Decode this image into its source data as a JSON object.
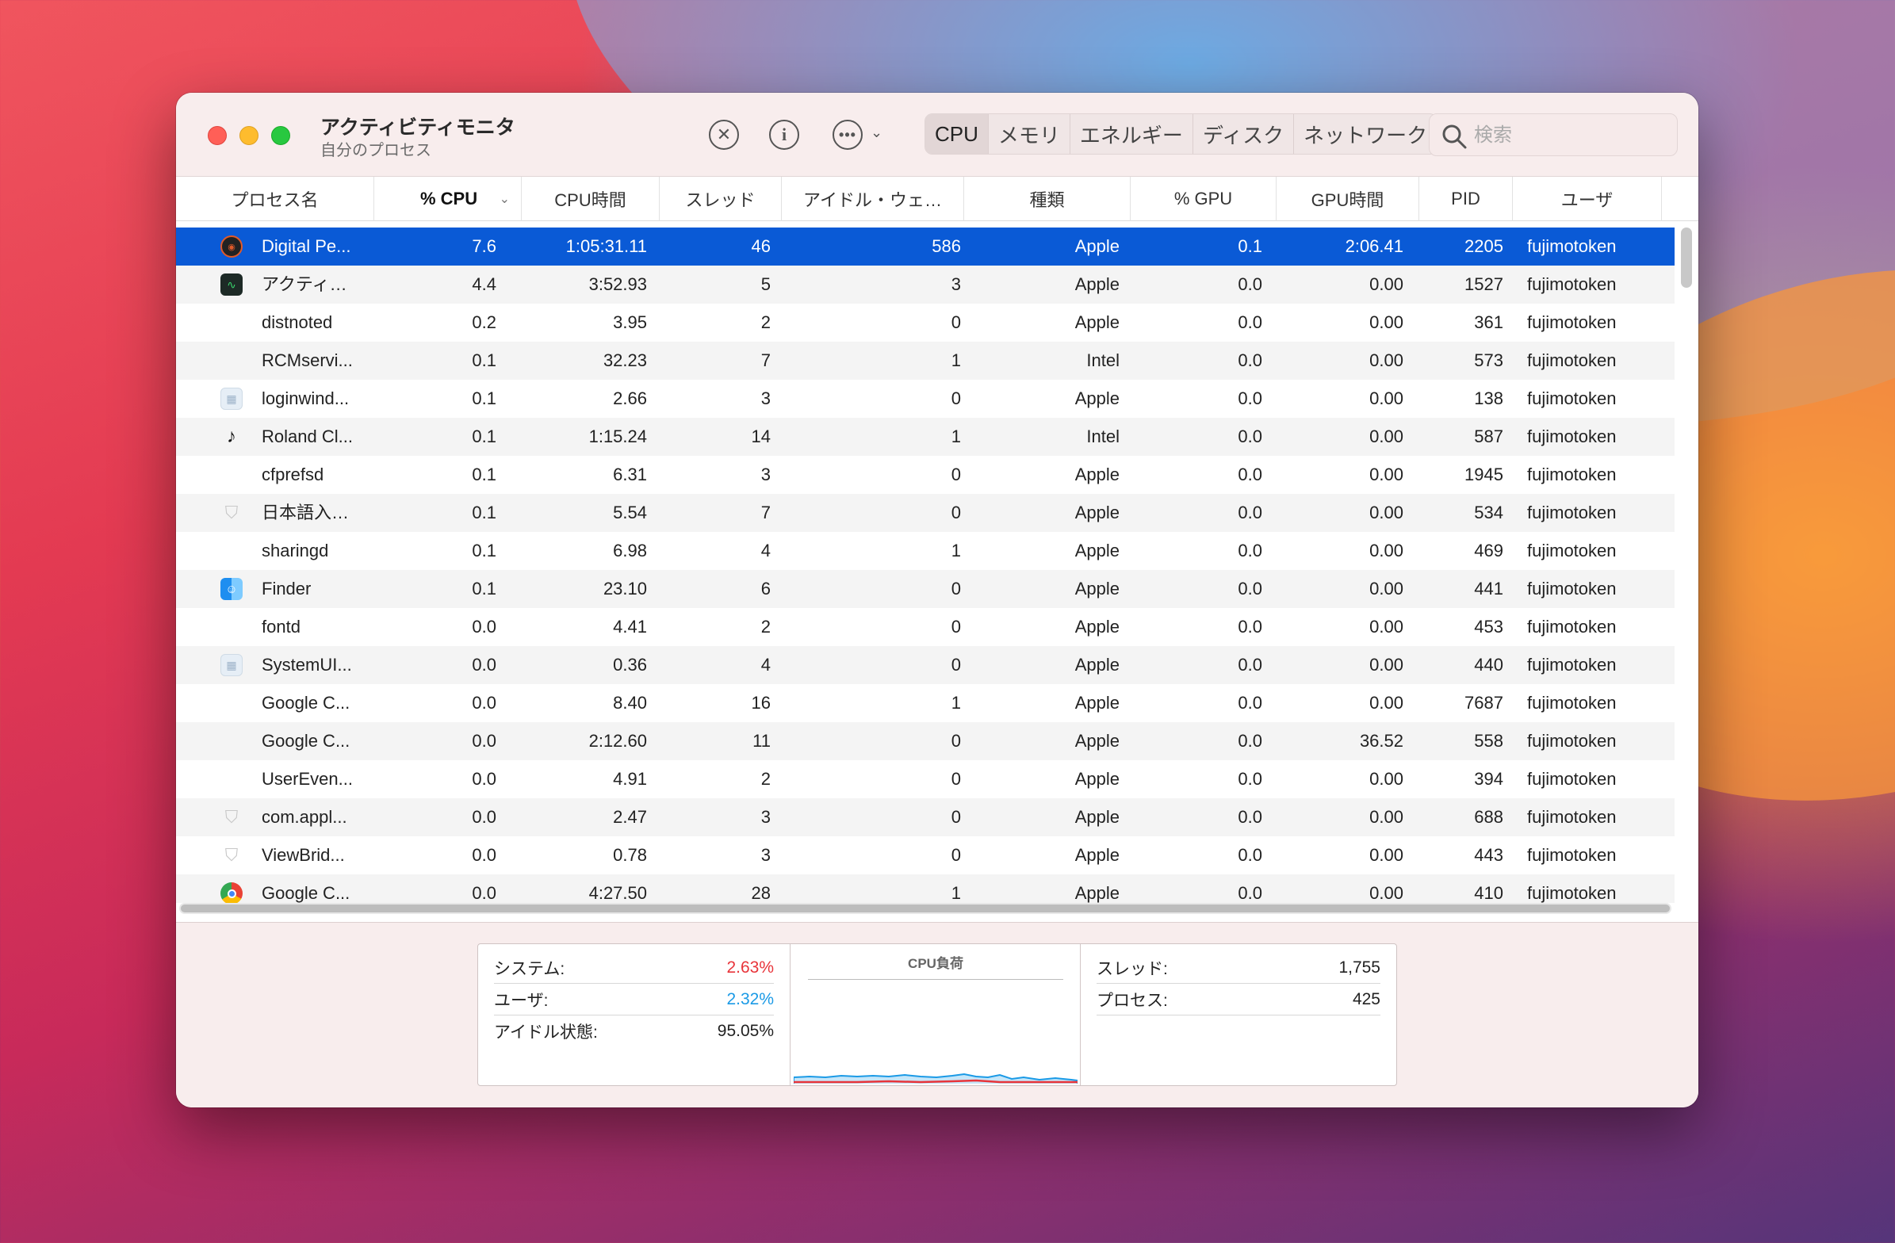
{
  "window": {
    "title": "アクティビティモニタ",
    "subtitle": "自分のプロセス"
  },
  "toolbar": {
    "stop_icon": "x-circle-icon",
    "info_icon": "info-icon",
    "more_icon": "ellipsis-circle-icon",
    "tabs": [
      {
        "label": "CPU",
        "active": true
      },
      {
        "label": "メモリ",
        "active": false
      },
      {
        "label": "エネルギー",
        "active": false
      },
      {
        "label": "ディスク",
        "active": false
      },
      {
        "label": "ネットワーク",
        "active": false
      }
    ],
    "search_placeholder": "検索"
  },
  "columns": [
    "プロセス名",
    "% CPU",
    "CPU時間",
    "スレッド",
    "アイドル・ウェ…",
    "種類",
    "% GPU",
    "GPU時間",
    "PID",
    "ユーザ"
  ],
  "sorted_column": "% CPU",
  "rows": [
    {
      "name": "Digital Pe...",
      "cpu": "7.6",
      "cpu_time": "1:05:31.11",
      "threads": "46",
      "idle_wake": "586",
      "kind": "Apple",
      "gpu": "0.1",
      "gpu_time": "2:06.41",
      "pid": "2205",
      "user": "fujimotoken",
      "icon": "dpm-icon"
    },
    {
      "name": "アクティ…",
      "cpu": "4.4",
      "cpu_time": "3:52.93",
      "threads": "5",
      "idle_wake": "3",
      "kind": "Apple",
      "gpu": "0.0",
      "gpu_time": "0.00",
      "pid": "1527",
      "user": "fujimotoken",
      "icon": "activity-monitor-icon"
    },
    {
      "name": "distnoted",
      "cpu": "0.2",
      "cpu_time": "3.95",
      "threads": "2",
      "idle_wake": "0",
      "kind": "Apple",
      "gpu": "0.0",
      "gpu_time": "0.00",
      "pid": "361",
      "user": "fujimotoken",
      "icon": ""
    },
    {
      "name": "RCMservi...",
      "cpu": "0.1",
      "cpu_time": "32.23",
      "threads": "7",
      "idle_wake": "1",
      "kind": "Intel",
      "gpu": "0.0",
      "gpu_time": "0.00",
      "pid": "573",
      "user": "fujimotoken",
      "icon": ""
    },
    {
      "name": "loginwind...",
      "cpu": "0.1",
      "cpu_time": "2.66",
      "threads": "3",
      "idle_wake": "0",
      "kind": "Apple",
      "gpu": "0.0",
      "gpu_time": "0.00",
      "pid": "138",
      "user": "fujimotoken",
      "icon": "window-grid-icon"
    },
    {
      "name": "Roland Cl...",
      "cpu": "0.1",
      "cpu_time": "1:15.24",
      "threads": "14",
      "idle_wake": "1",
      "kind": "Intel",
      "gpu": "0.0",
      "gpu_time": "0.00",
      "pid": "587",
      "user": "fujimotoken",
      "icon": "music-note-icon"
    },
    {
      "name": "cfprefsd",
      "cpu": "0.1",
      "cpu_time": "6.31",
      "threads": "3",
      "idle_wake": "0",
      "kind": "Apple",
      "gpu": "0.0",
      "gpu_time": "0.00",
      "pid": "1945",
      "user": "fujimotoken",
      "icon": ""
    },
    {
      "name": "日本語入…",
      "cpu": "0.1",
      "cpu_time": "5.54",
      "threads": "7",
      "idle_wake": "0",
      "kind": "Apple",
      "gpu": "0.0",
      "gpu_time": "0.00",
      "pid": "534",
      "user": "fujimotoken",
      "icon": "shield-icon"
    },
    {
      "name": "sharingd",
      "cpu": "0.1",
      "cpu_time": "6.98",
      "threads": "4",
      "idle_wake": "1",
      "kind": "Apple",
      "gpu": "0.0",
      "gpu_time": "0.00",
      "pid": "469",
      "user": "fujimotoken",
      "icon": ""
    },
    {
      "name": "Finder",
      "cpu": "0.1",
      "cpu_time": "23.10",
      "threads": "6",
      "idle_wake": "0",
      "kind": "Apple",
      "gpu": "0.0",
      "gpu_time": "0.00",
      "pid": "441",
      "user": "fujimotoken",
      "icon": "finder-icon"
    },
    {
      "name": "fontd",
      "cpu": "0.0",
      "cpu_time": "4.41",
      "threads": "2",
      "idle_wake": "0",
      "kind": "Apple",
      "gpu": "0.0",
      "gpu_time": "0.00",
      "pid": "453",
      "user": "fujimotoken",
      "icon": ""
    },
    {
      "name": "SystemUI...",
      "cpu": "0.0",
      "cpu_time": "0.36",
      "threads": "4",
      "idle_wake": "0",
      "kind": "Apple",
      "gpu": "0.0",
      "gpu_time": "0.00",
      "pid": "440",
      "user": "fujimotoken",
      "icon": "window-grid-icon"
    },
    {
      "name": "Google C...",
      "cpu": "0.0",
      "cpu_time": "8.40",
      "threads": "16",
      "idle_wake": "1",
      "kind": "Apple",
      "gpu": "0.0",
      "gpu_time": "0.00",
      "pid": "7687",
      "user": "fujimotoken",
      "icon": ""
    },
    {
      "name": "Google C...",
      "cpu": "0.0",
      "cpu_time": "2:12.60",
      "threads": "11",
      "idle_wake": "0",
      "kind": "Apple",
      "gpu": "0.0",
      "gpu_time": "36.52",
      "pid": "558",
      "user": "fujimotoken",
      "icon": ""
    },
    {
      "name": "UserEven...",
      "cpu": "0.0",
      "cpu_time": "4.91",
      "threads": "2",
      "idle_wake": "0",
      "kind": "Apple",
      "gpu": "0.0",
      "gpu_time": "0.00",
      "pid": "394",
      "user": "fujimotoken",
      "icon": ""
    },
    {
      "name": "com.appl...",
      "cpu": "0.0",
      "cpu_time": "2.47",
      "threads": "3",
      "idle_wake": "0",
      "kind": "Apple",
      "gpu": "0.0",
      "gpu_time": "0.00",
      "pid": "688",
      "user": "fujimotoken",
      "icon": "shield-icon"
    },
    {
      "name": "ViewBrid...",
      "cpu": "0.0",
      "cpu_time": "0.78",
      "threads": "3",
      "idle_wake": "0",
      "kind": "Apple",
      "gpu": "0.0",
      "gpu_time": "0.00",
      "pid": "443",
      "user": "fujimotoken",
      "icon": "shield-icon"
    },
    {
      "name": "Google C...",
      "cpu": "0.0",
      "cpu_time": "4:27.50",
      "threads": "28",
      "idle_wake": "1",
      "kind": "Apple",
      "gpu": "0.0",
      "gpu_time": "0.00",
      "pid": "410",
      "user": "fujimotoken",
      "icon": "chrome-icon"
    }
  ],
  "stats": {
    "system_label": "システム:",
    "system_value": "2.63%",
    "user_label": "ユーザ:",
    "user_value": "2.32%",
    "idle_label": "アイドル状態:",
    "idle_value": "95.05%",
    "chart_title": "CPU負荷",
    "threads_label": "スレッド:",
    "threads_value": "1,755",
    "processes_label": "プロセス:",
    "processes_value": "425"
  },
  "colors": {
    "selection": "#0a5ad6",
    "system": "#e8343a",
    "user": "#1a9ae6"
  }
}
